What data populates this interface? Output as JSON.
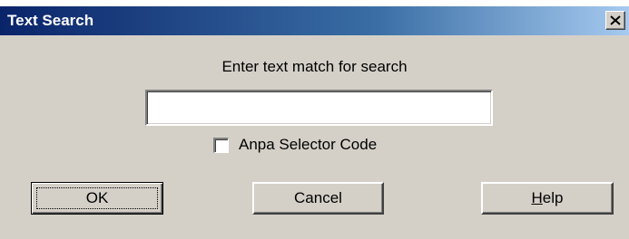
{
  "window": {
    "title": "Text Search",
    "close_icon": "close-icon"
  },
  "prompt": "Enter text match for search",
  "search": {
    "value": "",
    "placeholder": ""
  },
  "checkbox": {
    "label": "Anpa Selector Code",
    "checked": false
  },
  "buttons": {
    "ok": "OK",
    "cancel": "Cancel",
    "help": "Help"
  },
  "colors": {
    "titlebar_start": "#0a246a",
    "titlebar_end": "#a6caf0",
    "dialog_face": "#d4d0c8"
  }
}
